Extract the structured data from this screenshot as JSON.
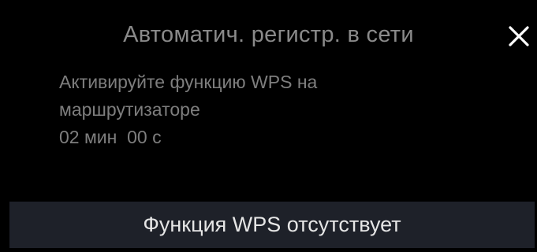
{
  "dialog": {
    "title": "Автоматич. регистр. в сети",
    "close_icon": "close-icon",
    "message_line1": "Активируйте функцию WPS на",
    "message_line2": "маршрутизаторе",
    "timer": "02 мин  00 с",
    "wps_button_label": "Функция WPS отсутствует"
  },
  "colors": {
    "background": "#000000",
    "title_text": "#8a8a8a",
    "message_text": "#7e7e7e",
    "button_bg": "#1e2129",
    "button_text": "#e6e6e6",
    "close_icon": "#ffffff"
  }
}
